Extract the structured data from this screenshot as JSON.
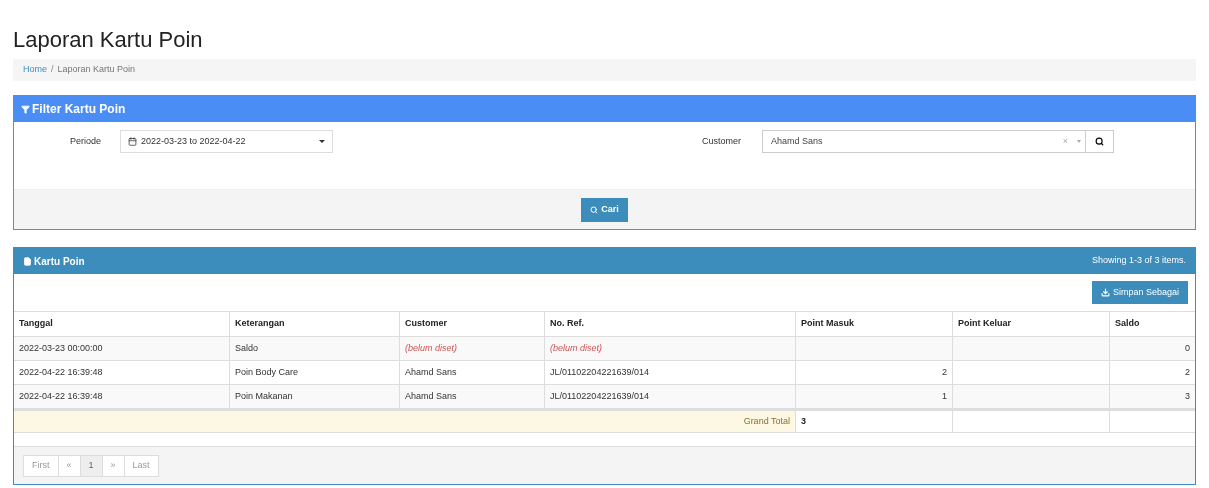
{
  "page_title": "Laporan Kartu Poin",
  "breadcrumb_separator": "/",
  "breadcrumb": [
    {
      "label": "Home",
      "link": true
    },
    {
      "label": "Laporan Kartu Poin",
      "link": false
    }
  ],
  "filter_panel": {
    "title": "Filter Kartu Poin",
    "periode_label": "Periode",
    "periode_value": "2022-03-23 to 2022-04-22",
    "customer_label": "Customer",
    "customer_value": "Ahamd Sans",
    "clear_mark": "×",
    "search_button": "Cari"
  },
  "report_panel": {
    "title": "Kartu Poin",
    "summary": "Showing 1-3 of 3 items.",
    "export_button": "Simpan Sebagai",
    "columns": [
      "Tanggal",
      "Keterangan",
      "Customer",
      "No. Ref.",
      "Point Masuk",
      "Point Keluar",
      "Saldo"
    ],
    "rows": [
      [
        {
          "kind": "text",
          "text": "2022-03-23 00:00:00"
        },
        {
          "kind": "text",
          "text": "Saldo"
        },
        {
          "kind": "unset",
          "text": "(belum diset)"
        },
        {
          "kind": "unset",
          "text": "(belum diset)"
        },
        {
          "kind": "empty"
        },
        {
          "kind": "empty"
        },
        {
          "kind": "number",
          "text": "0"
        }
      ],
      [
        {
          "kind": "text",
          "text": "2022-04-22 16:39:48"
        },
        {
          "kind": "text",
          "text": "Poin Body Care"
        },
        {
          "kind": "text",
          "text": "Ahamd Sans"
        },
        {
          "kind": "text",
          "text": "JL/01102204221639/014"
        },
        {
          "kind": "number",
          "text": "2"
        },
        {
          "kind": "empty"
        },
        {
          "kind": "number",
          "text": "2"
        }
      ],
      [
        {
          "kind": "text",
          "text": "2022-04-22 16:39:48"
        },
        {
          "kind": "text",
          "text": "Poin Makanan"
        },
        {
          "kind": "text",
          "text": "Ahamd Sans"
        },
        {
          "kind": "text",
          "text": "JL/01102204221639/014"
        },
        {
          "kind": "number",
          "text": "1"
        },
        {
          "kind": "empty"
        },
        {
          "kind": "number",
          "text": "3"
        }
      ]
    ],
    "grand_total_label": "Grand Total",
    "grand_total_value": "3",
    "pagination": [
      {
        "label": "First",
        "selected": false,
        "disabled": true
      },
      {
        "label": "«",
        "selected": false,
        "disabled": true
      },
      {
        "label": "1",
        "selected": true,
        "disabled": false
      },
      {
        "label": "»",
        "selected": false,
        "disabled": true
      },
      {
        "label": "Last",
        "selected": false,
        "disabled": true
      }
    ]
  }
}
